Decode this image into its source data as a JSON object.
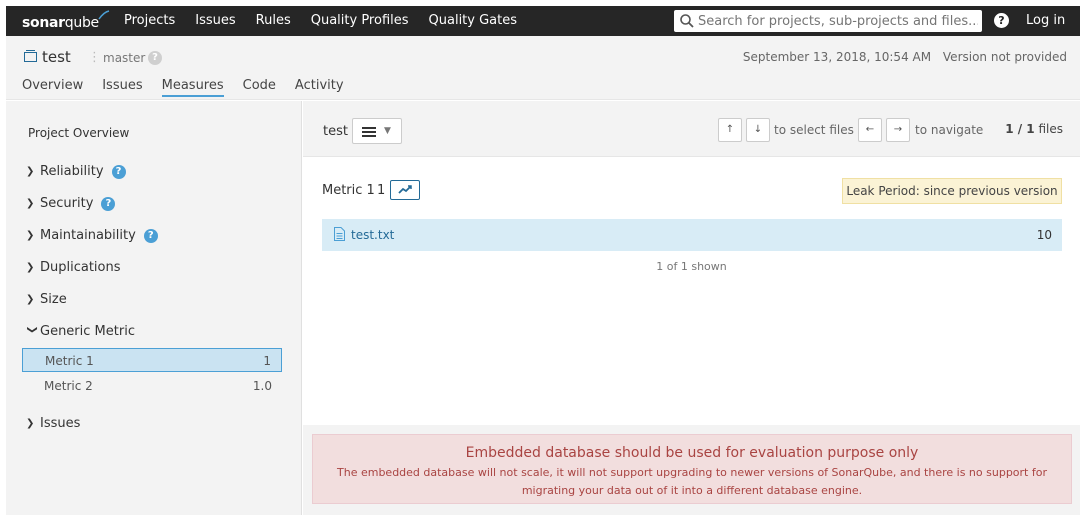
{
  "topbar": {
    "logo_main": "sonar",
    "logo_accent": "qube",
    "nav": [
      "Projects",
      "Issues",
      "Rules",
      "Quality Profiles",
      "Quality Gates"
    ],
    "search_placeholder": "Search for projects, sub-projects and files...",
    "help_label": "?",
    "login_label": "Log in"
  },
  "context": {
    "project_name": "test",
    "branch": "master",
    "branch_help": "?",
    "date": "September 13, 2018, 10:54 AM",
    "version": "Version not provided",
    "tabs": [
      "Overview",
      "Issues",
      "Measures",
      "Code",
      "Activity"
    ],
    "active_tab": "Measures"
  },
  "sidebar": {
    "title": "Project Overview",
    "categories": [
      {
        "label": "Reliability",
        "help": "?"
      },
      {
        "label": "Security",
        "help": "?"
      },
      {
        "label": "Maintainability",
        "help": "?"
      },
      {
        "label": "Duplications"
      },
      {
        "label": "Size"
      },
      {
        "label": "Generic Metric",
        "expanded": true
      },
      {
        "label": "Issues"
      }
    ],
    "metrics": [
      {
        "label": "Metric 1",
        "value": "1",
        "selected": true
      },
      {
        "label": "Metric 2",
        "value": "1.0"
      }
    ]
  },
  "main": {
    "component": "test",
    "up_key": "↑",
    "down_key": "↓",
    "select_label": "to select files",
    "left_key": "←",
    "right_key": "→",
    "navigate_label": "to navigate",
    "files_count": "1 / 1",
    "files_label": "files",
    "metric_name": "Metric 1",
    "metric_value": "1",
    "leak_period": "Leak Period: since previous version",
    "file_name": "test.txt",
    "file_value": "10",
    "shown_text": "1 of 1 shown"
  },
  "alert": {
    "title": "Embedded database should be used for evaluation purpose only",
    "message": "The embedded database will not scale, it will not support upgrading to newer versions of SonarQube, and there is no support for migrating your data out of it into a different database engine."
  },
  "colors": {
    "topbar": "#262626",
    "accent": "#4b9fd5",
    "selected_bg": "#cae3f2",
    "alert_text": "#a94442"
  }
}
